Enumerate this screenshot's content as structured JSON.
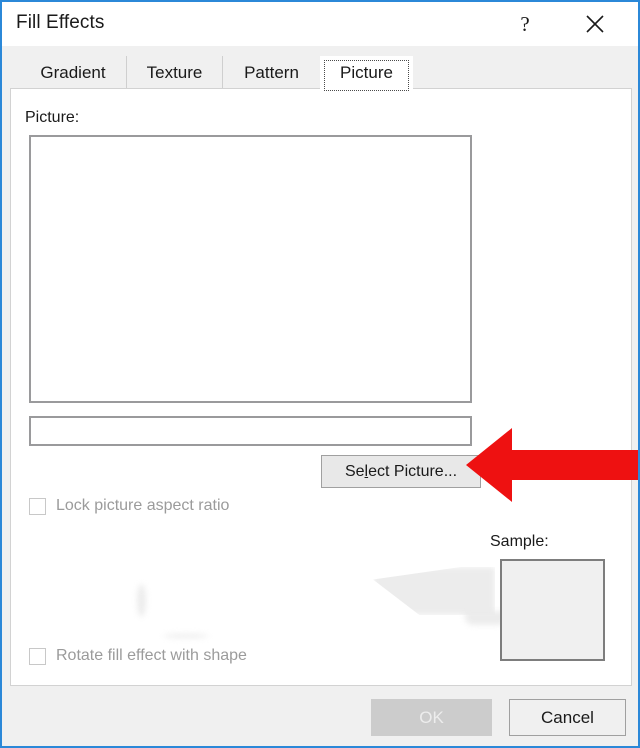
{
  "window": {
    "title": "Fill Effects",
    "help_icon": "question-mark-icon",
    "close_icon": "close-x-icon",
    "border_color": "#2b88d8"
  },
  "tabs": [
    {
      "label": "Gradient",
      "active": false
    },
    {
      "label": "Texture",
      "active": false
    },
    {
      "label": "Pattern",
      "active": false
    },
    {
      "label": "Picture",
      "active": true
    }
  ],
  "picture_panel": {
    "label": "Picture:",
    "preview_value": "",
    "path_input_value": "",
    "path_input_placeholder": "",
    "select_picture_button": {
      "prefix": "Se",
      "accel": "l",
      "suffix": "ect Picture..."
    }
  },
  "options": [
    {
      "label": "Lock picture aspect ratio",
      "checked": false,
      "enabled": false
    },
    {
      "label": "Rotate fill effect with shape",
      "checked": false,
      "enabled": false
    }
  ],
  "sample": {
    "label": "Sample:",
    "swatch_color": "#f0f0f0"
  },
  "footer": {
    "ok_label": "OK",
    "ok_enabled": false,
    "cancel_label": "Cancel",
    "cancel_enabled": true
  },
  "annotation": {
    "name": "red-left-arrow",
    "color": "#ee1111",
    "points_at": "Select Picture..."
  }
}
